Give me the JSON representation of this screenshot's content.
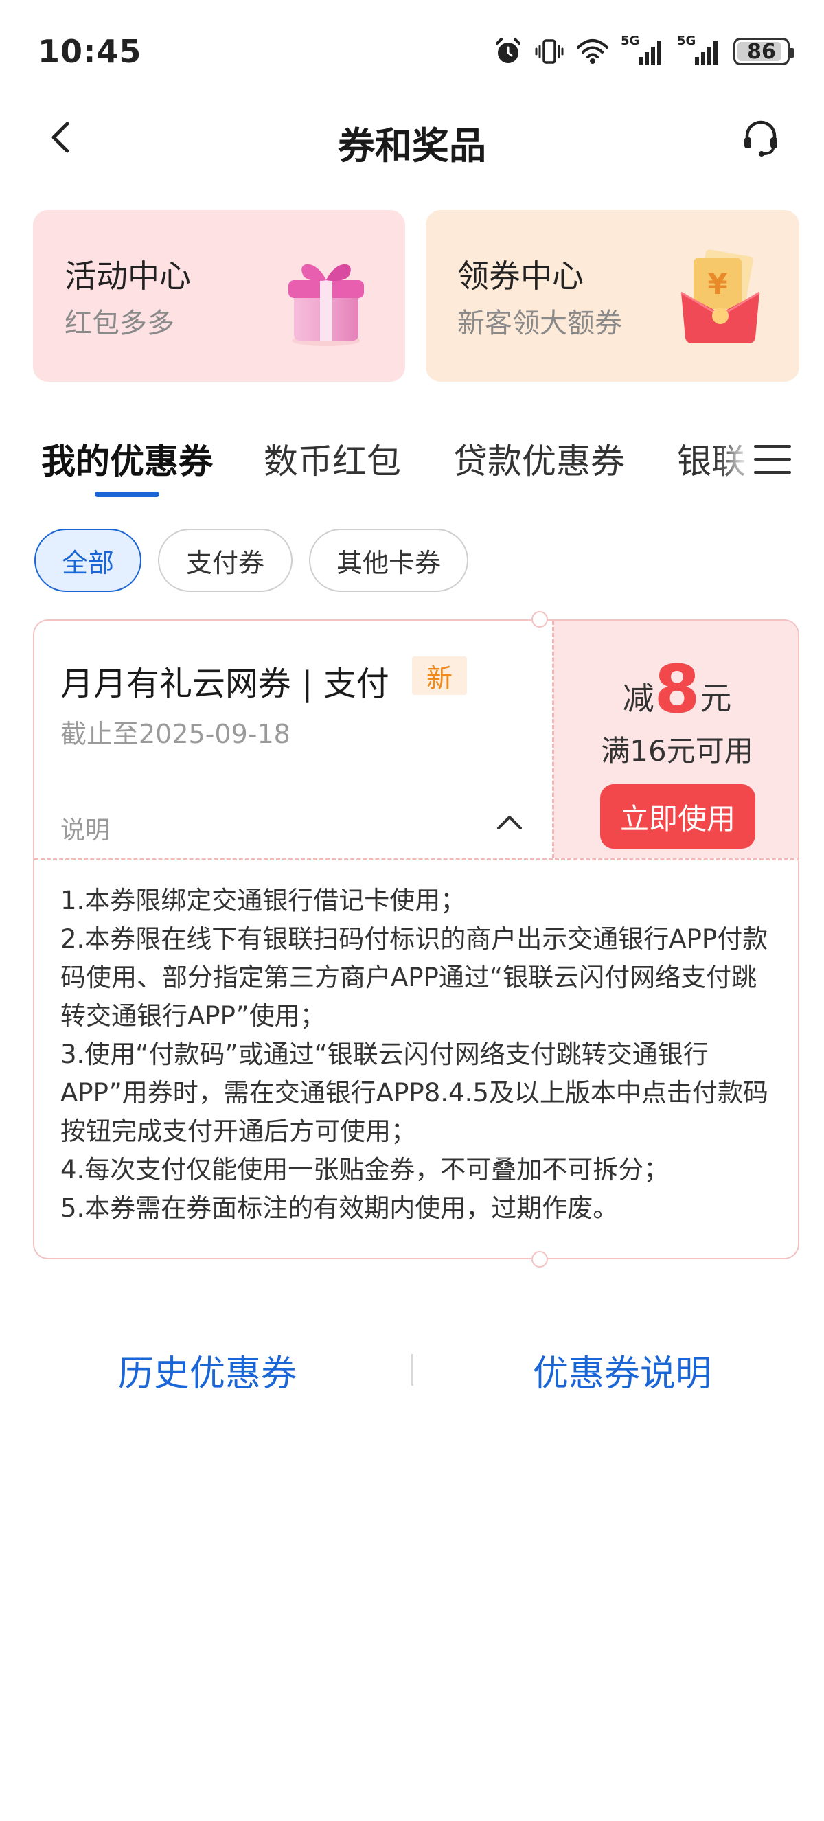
{
  "status_bar": {
    "time": "10:45",
    "battery": "86",
    "signal1_label": "5G",
    "signal2_label": "5G",
    "icons": [
      "alarm-icon",
      "vibrate-icon",
      "wifi-icon",
      "signal-icon",
      "signal-icon",
      "battery-icon"
    ]
  },
  "nav": {
    "title": "券和奖品",
    "back_icon": "chevron-left-icon",
    "service_icon": "headset-icon"
  },
  "entries": [
    {
      "title": "活动中心",
      "subtitle": "红包多多",
      "icon": "gift-box-icon",
      "background": "#fde1e3"
    },
    {
      "title": "领券中心",
      "subtitle": "新客领大额券",
      "icon": "red-envelope-icon",
      "background": "#feead8"
    }
  ],
  "tabs": [
    {
      "label": "我的优惠券",
      "active": true
    },
    {
      "label": "数币红包",
      "active": false
    },
    {
      "label": "贷款优惠券",
      "active": false
    },
    {
      "label": "银联",
      "active": false
    }
  ],
  "tabs_menu_icon": "menu-icon",
  "filters": [
    {
      "label": "全部",
      "active": true
    },
    {
      "label": "支付券",
      "active": false
    },
    {
      "label": "其他卡券",
      "active": false
    }
  ],
  "coupon": {
    "name": "月月有礼云网券 | 支付",
    "badge": "新",
    "expiry": "截止至2025-09-18",
    "amount_prefix": "减",
    "amount": "8",
    "amount_unit": "元",
    "condition": "满16元可用",
    "use_button": "立即使用",
    "desc_label": "说明",
    "rules": [
      "1.本券限绑定交通银行借记卡使用；",
      "2.本券限在线下有银联扫码付标识的商户出示交通银行APP付款码使用、部分指定第三方商户APP通过“银联云闪付网络支付跳转交通银行APP”使用；",
      "3.使用“付款码”或通过“银联云闪付网络支付跳转交通银行APP”用券时，需在交通银行APP8.4.5及以上版本中点击付款码按钮完成支付开通后方可使用；",
      "4.每次支付仅能使用一张贴金券，不可叠加不可拆分；",
      "5.本券需在券面标注的有效期内使用，过期作废。"
    ]
  },
  "bottom_links": {
    "history": "历史优惠券",
    "explain": "优惠券说明"
  },
  "colors": {
    "accent_blue": "#1a66d6",
    "coupon_red": "#f2484b",
    "badge_orange": "#f08a1c"
  }
}
